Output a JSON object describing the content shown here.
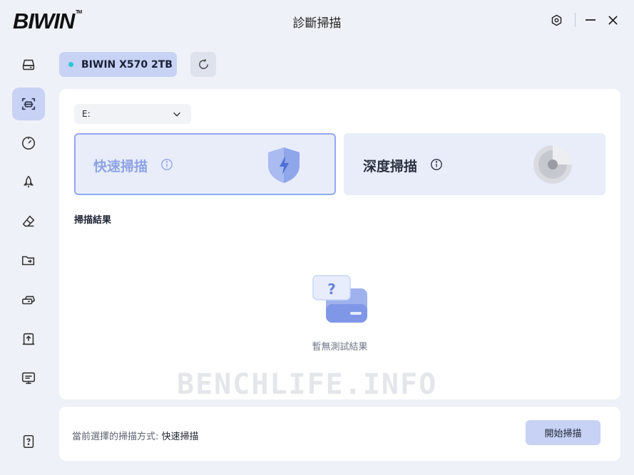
{
  "app": {
    "logo": "BIWIN",
    "logo_mark": "TM",
    "title": "診斷掃描"
  },
  "window_controls": [
    {
      "name": "settings",
      "icon": "gear-icon"
    },
    {
      "name": "minimize",
      "icon": "minimize-icon"
    },
    {
      "name": "close",
      "icon": "close-icon"
    }
  ],
  "sidebar": {
    "items": [
      {
        "icon": "drive-icon",
        "active": false
      },
      {
        "icon": "scan-icon",
        "active": true
      },
      {
        "icon": "speedometer-icon",
        "active": false
      },
      {
        "icon": "rocket-icon",
        "active": false
      },
      {
        "icon": "eraser-icon",
        "active": false
      },
      {
        "icon": "folder-transfer-icon",
        "active": false
      },
      {
        "icon": "drive-clone-icon",
        "active": false
      },
      {
        "icon": "firmware-update-icon",
        "active": false
      },
      {
        "icon": "monitor-info-icon",
        "active": false
      }
    ],
    "help_icon": "help-icon"
  },
  "device": {
    "name": "BIWIN X570 2TB",
    "status_color": "#2ec5d8"
  },
  "drive_select": {
    "value": "E:"
  },
  "scan_modes": {
    "quick": {
      "label": "快速掃描",
      "selected": true
    },
    "deep": {
      "label": "深度掃描",
      "selected": false
    }
  },
  "results": {
    "title": "掃描結果",
    "empty_text": "暫無測試結果"
  },
  "watermark": "BENCHLIFE.INFO",
  "footer": {
    "current_label": "當前選擇的掃描方式: ",
    "current_value": "快速掃描",
    "start_button": "開始掃描"
  },
  "colors": {
    "accent": "#c7d2f4",
    "selected_border": "#93a9ee",
    "status_dot": "#2ec5d8"
  }
}
